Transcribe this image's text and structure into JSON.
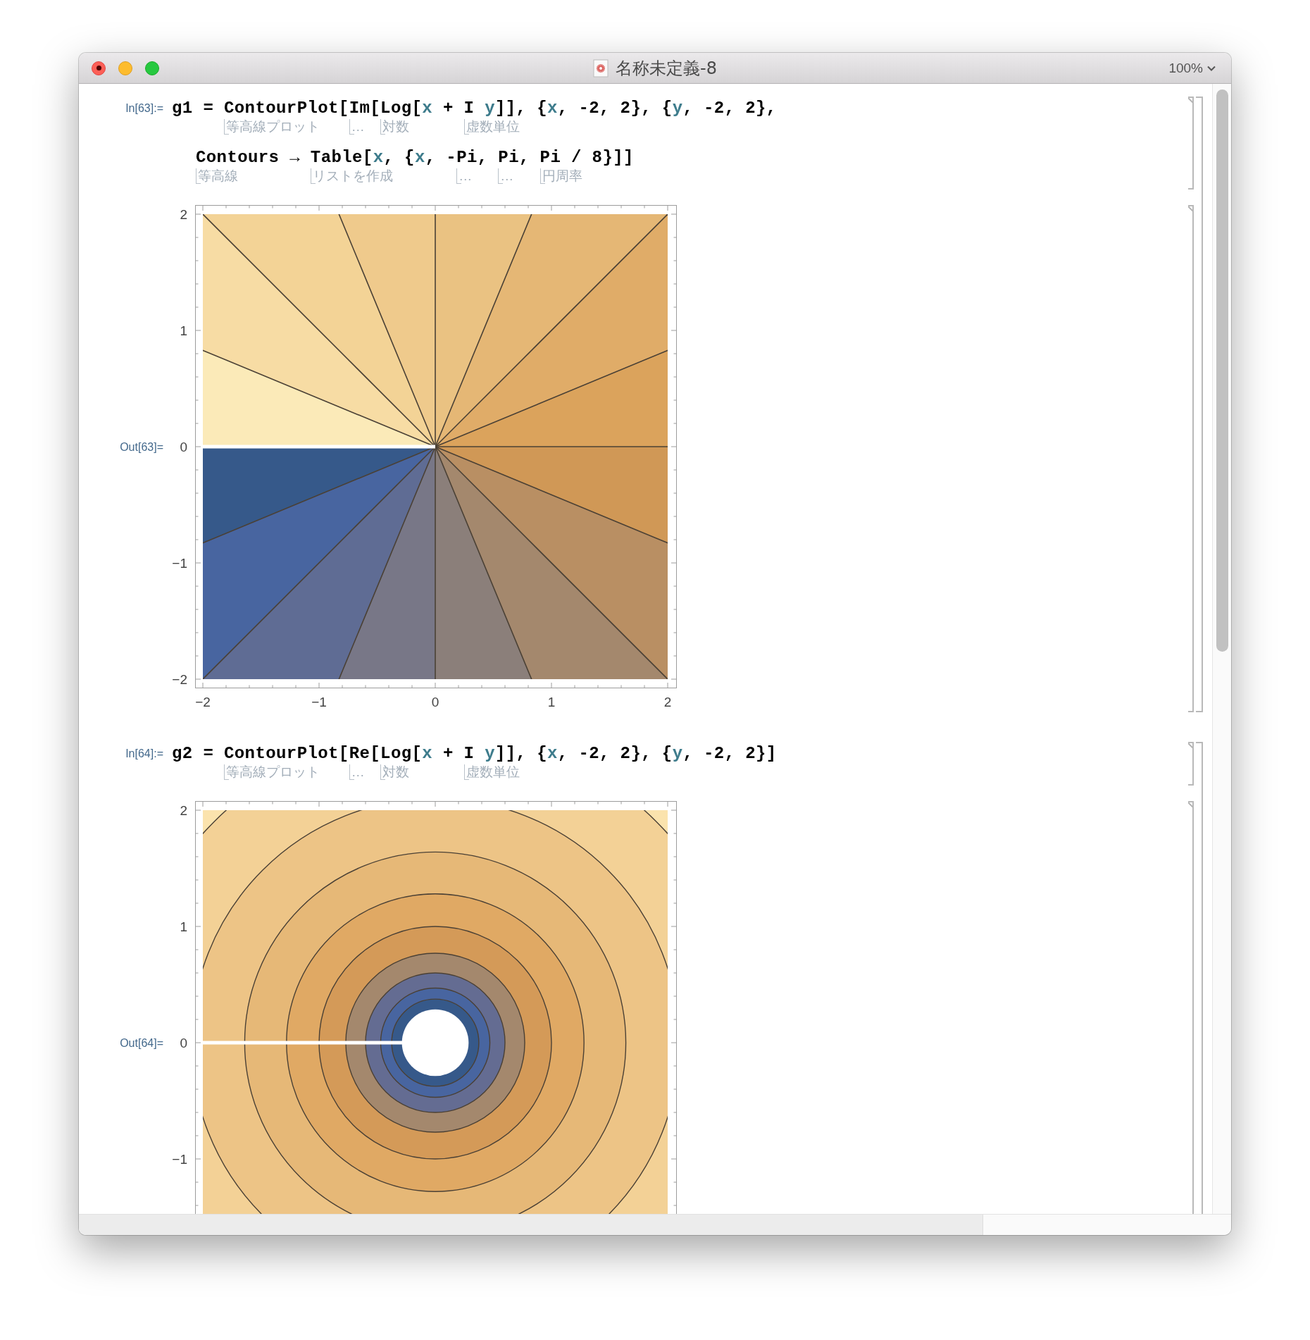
{
  "window": {
    "title": "名称未定義-8",
    "zoom": "100%"
  },
  "groups": [
    {
      "input": {
        "label": "In[63]:=",
        "lines": [
          {
            "tokens": [
              {
                "text": "g1 = ",
                "kind": "plain"
              },
              {
                "text": "ContourPlot",
                "kind": "plain",
                "note": "等高線プロット"
              },
              {
                "text": "[",
                "kind": "plain"
              },
              {
                "text": "Im",
                "kind": "plain",
                "note": "…"
              },
              {
                "text": "[",
                "kind": "plain"
              },
              {
                "text": "Log",
                "kind": "plain",
                "note": "対数"
              },
              {
                "text": "[",
                "kind": "plain"
              },
              {
                "text": "x",
                "kind": "var"
              },
              {
                "text": " + ",
                "kind": "plain"
              },
              {
                "text": "I",
                "kind": "plain",
                "note": "虚数単位"
              },
              {
                "text": " y",
                "kind": "var"
              },
              {
                "text": "]], {",
                "kind": "plain"
              },
              {
                "text": "x",
                "kind": "var"
              },
              {
                "text": ", -2, 2}, {",
                "kind": "plain"
              },
              {
                "text": "y",
                "kind": "var"
              },
              {
                "text": ", -2, 2},",
                "kind": "plain"
              }
            ]
          },
          {
            "tokens": [
              {
                "text": "Contours",
                "kind": "plain",
                "note": "等高線"
              },
              {
                "text": " → ",
                "kind": "plain"
              },
              {
                "text": "Table",
                "kind": "plain",
                "note": "リストを作成"
              },
              {
                "text": "[",
                "kind": "plain"
              },
              {
                "text": "x",
                "kind": "var"
              },
              {
                "text": ", {",
                "kind": "plain"
              },
              {
                "text": "x",
                "kind": "var"
              },
              {
                "text": ", -",
                "kind": "plain"
              },
              {
                "text": "Pi",
                "kind": "plain",
                "note": "…"
              },
              {
                "text": ", ",
                "kind": "plain"
              },
              {
                "text": "Pi",
                "kind": "plain",
                "note": "…"
              },
              {
                "text": ", ",
                "kind": "plain"
              },
              {
                "text": "Pi",
                "kind": "plain",
                "note": "円周率"
              },
              {
                "text": " / 8}]]",
                "kind": "plain"
              }
            ]
          }
        ]
      },
      "output": {
        "label": "Out[63]=",
        "plot": {
          "kind": "argument",
          "y_ticks": [
            "2",
            "1",
            "0",
            "−1",
            "−2"
          ],
          "x_ticks": [
            "−2",
            "−1",
            "0",
            "1",
            "2"
          ]
        }
      }
    },
    {
      "input": {
        "label": "In[64]:=",
        "lines": [
          {
            "tokens": [
              {
                "text": "g2 = ",
                "kind": "plain"
              },
              {
                "text": "ContourPlot",
                "kind": "plain",
                "note": "等高線プロット"
              },
              {
                "text": "[",
                "kind": "plain"
              },
              {
                "text": "Re",
                "kind": "plain",
                "note": "…"
              },
              {
                "text": "[",
                "kind": "plain"
              },
              {
                "text": "Log",
                "kind": "plain",
                "note": "対数"
              },
              {
                "text": "[",
                "kind": "plain"
              },
              {
                "text": "x",
                "kind": "var"
              },
              {
                "text": " + ",
                "kind": "plain"
              },
              {
                "text": "I",
                "kind": "plain",
                "note": "虚数単位"
              },
              {
                "text": " y",
                "kind": "var"
              },
              {
                "text": "]], {",
                "kind": "plain"
              },
              {
                "text": "x",
                "kind": "var"
              },
              {
                "text": ", -2, 2}, {",
                "kind": "plain"
              },
              {
                "text": "y",
                "kind": "var"
              },
              {
                "text": ", -2, 2}]",
                "kind": "plain"
              }
            ]
          }
        ]
      },
      "output": {
        "label": "Out[64]=",
        "plot": {
          "kind": "modulus",
          "y_ticks": [
            "2",
            "1",
            "0",
            "−1"
          ]
        }
      }
    }
  ]
}
